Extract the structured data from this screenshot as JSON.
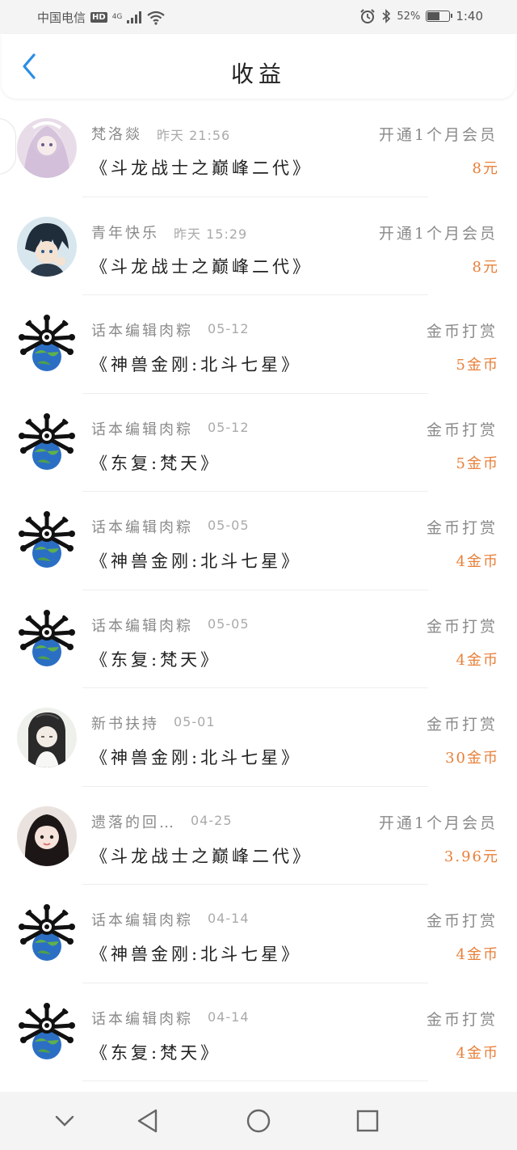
{
  "status_bar": {
    "carrier": "中国电信",
    "hd": "HD",
    "network": "4G",
    "battery_text": "52%",
    "battery_level": 0.52,
    "time": "1:40"
  },
  "header": {
    "title": "收益"
  },
  "colors": {
    "accent_blue": "#2a8ee6",
    "amount_orange": "#e8803a",
    "muted_text": "#8a8a8a"
  },
  "records": [
    {
      "user": "梵洛燚",
      "time": "昨天 21:56",
      "type": "开通1个月会员",
      "book": "《斗龙战士之巅峰二代》",
      "amount": "8元",
      "avatar": "anime-girl-avatar"
    },
    {
      "user": "青年快乐",
      "time": "昨天 15:29",
      "type": "开通1个月会员",
      "book": "《斗龙战士之巅峰二代》",
      "amount": "8元",
      "avatar": "anime-boy-avatar"
    },
    {
      "user": "话本编辑肉粽",
      "time": "05-12",
      "type": "金币打赏",
      "book": "《神兽金刚:北斗七星》",
      "amount": "5金币",
      "avatar": "globe-mascot-avatar"
    },
    {
      "user": "话本编辑肉粽",
      "time": "05-12",
      "type": "金币打赏",
      "book": "《东复:梵天》",
      "amount": "5金币",
      "avatar": "globe-mascot-avatar"
    },
    {
      "user": "话本编辑肉粽",
      "time": "05-05",
      "type": "金币打赏",
      "book": "《神兽金刚:北斗七星》",
      "amount": "4金币",
      "avatar": "globe-mascot-avatar"
    },
    {
      "user": "话本编辑肉粽",
      "time": "05-05",
      "type": "金币打赏",
      "book": "《东复:梵天》",
      "amount": "4金币",
      "avatar": "globe-mascot-avatar"
    },
    {
      "user": "新书扶持",
      "time": "05-01",
      "type": "金币打赏",
      "book": "《神兽金刚:北斗七星》",
      "amount": "30金币",
      "avatar": "ink-painting-avatar"
    },
    {
      "user": "遗落的回…",
      "time": "04-25",
      "type": "开通1个月会员",
      "book": "《斗龙战士之巅峰二代》",
      "amount": "3.96元",
      "avatar": "girl-photo-avatar"
    },
    {
      "user": "话本编辑肉粽",
      "time": "04-14",
      "type": "金币打赏",
      "book": "《神兽金刚:北斗七星》",
      "amount": "4金币",
      "avatar": "globe-mascot-avatar"
    },
    {
      "user": "话本编辑肉粽",
      "time": "04-14",
      "type": "金币打赏",
      "book": "《东复:梵天》",
      "amount": "4金币",
      "avatar": "globe-mascot-avatar"
    }
  ],
  "nav": {
    "buttons": [
      "collapse-icon",
      "back-triangle-icon",
      "home-circle-icon",
      "recents-square-icon"
    ]
  }
}
